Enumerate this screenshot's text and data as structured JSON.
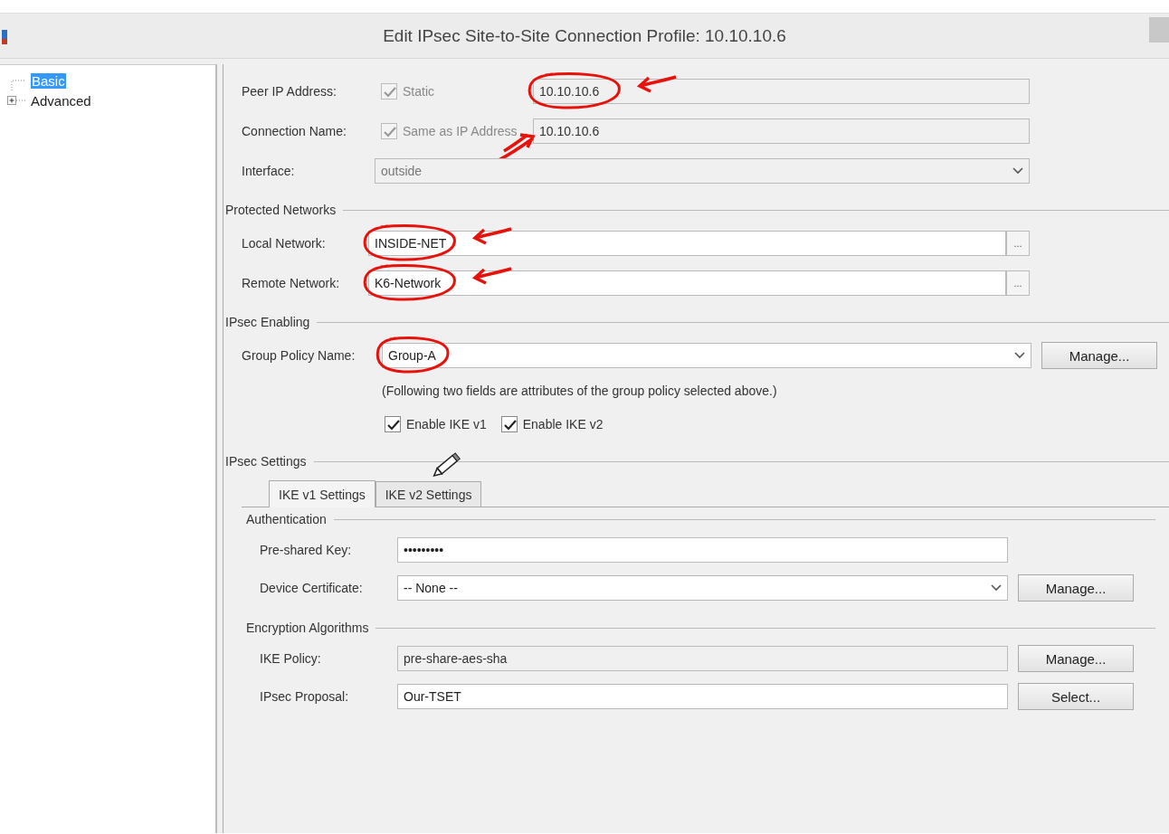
{
  "window": {
    "title": "Edit IPsec Site-to-Site Connection Profile: 10.10.10.6"
  },
  "tree": [
    {
      "label": "Basic",
      "kind": "leaf",
      "selected": true
    },
    {
      "label": "Advanced",
      "kind": "collapsed",
      "selected": false
    }
  ],
  "sections": [
    {
      "rows": [
        {
          "kind": "text",
          "label": "Peer IP Address:",
          "checkbox": {
            "label": "Static",
            "checked": true,
            "disabled": true
          },
          "value": "10.10.10.6",
          "disabled": true,
          "circled": true,
          "arrow_right": true,
          "arrow_left": false
        },
        {
          "kind": "text",
          "label": "Connection Name:",
          "checkbox": {
            "label": "Same as IP Address",
            "checked": true,
            "disabled": true
          },
          "value": "10.10.10.6",
          "disabled": true,
          "circled": false,
          "arrow_right": false,
          "arrow_left": true
        },
        {
          "kind": "select",
          "label": "Interface:",
          "value": "outside",
          "disabled": true,
          "circled": false,
          "arrow_right": false,
          "arrow_left": false
        }
      ]
    },
    {
      "title": "Protected Networks",
      "rows": [
        {
          "kind": "browse",
          "label": "Local Network:",
          "value": "INSIDE-NET",
          "browse": "...",
          "disabled": false,
          "circled": true,
          "arrow_right": true,
          "arrow_left": false
        },
        {
          "kind": "browse",
          "label": "Remote Network:",
          "value": "K6-Network",
          "browse": "...",
          "disabled": false,
          "circled": true,
          "arrow_right": true,
          "arrow_left": false
        }
      ]
    },
    {
      "title": "IPsec Enabling",
      "rows": [
        {
          "kind": "select",
          "label": "Group Policy Name:",
          "value": "Group-A",
          "button": "Manage...",
          "disabled": false,
          "circled": true,
          "arrow_right": false,
          "arrow_left": false
        },
        {
          "kind": "note",
          "text": "(Following two fields are attributes of the group policy selected above.)"
        },
        {
          "kind": "checks",
          "items": [
            {
              "label": "Enable IKE v1",
              "checked": true
            },
            {
              "label": "Enable IKE v2",
              "checked": true
            }
          ]
        }
      ]
    },
    {
      "title": "IPsec Settings",
      "tabs": [
        {
          "label": "IKE v1 Settings",
          "selected": true
        },
        {
          "label": "IKE v2 Settings",
          "selected": false
        }
      ],
      "groups": [
        {
          "title": "Authentication",
          "rows": [
            {
              "kind": "text",
              "label": "Pre-shared Key:",
              "value": "•••••••••",
              "disabled": false
            },
            {
              "kind": "select",
              "label": "Device Certificate:",
              "value": "-- None --",
              "button": "Manage...",
              "disabled": false
            }
          ]
        },
        {
          "title": "Encryption Algorithms",
          "rows": [
            {
              "kind": "text",
              "label": "IKE Policy:",
              "value": "pre-share-aes-sha",
              "button": "Manage...",
              "disabled": true
            },
            {
              "kind": "text",
              "label": "IPsec Proposal:",
              "value": "Our-TSET",
              "button": "Select...",
              "disabled": false
            }
          ]
        }
      ]
    }
  ]
}
